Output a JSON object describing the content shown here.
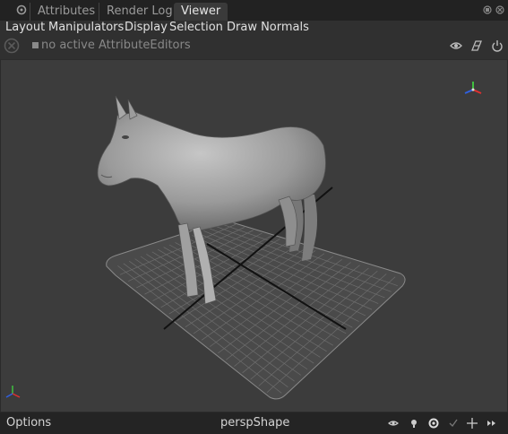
{
  "tabs": [
    {
      "label": "Attributes",
      "active": false
    },
    {
      "label": "Render Log",
      "active": false
    },
    {
      "label": "Viewer",
      "active": true
    }
  ],
  "window_buttons": [
    "float-icon",
    "close-icon"
  ],
  "menu": [
    "Layout",
    "Manipulators",
    "Display",
    "Selection",
    "Draw Normals"
  ],
  "toolbar": {
    "status": "no active AttributeEditors",
    "icons": [
      "eye-icon",
      "render-icon",
      "power-icon"
    ]
  },
  "viewport": {
    "object": "horse",
    "grid": true,
    "colors": {
      "background": "#3c3c3c",
      "grid": "#7a7a7a",
      "axis": "#111111",
      "gizmo_x": "#e03030",
      "gizmo_y": "#40c040",
      "gizmo_z": "#3060e0"
    }
  },
  "bottom": {
    "options_label": "Options",
    "camera": "perspShape",
    "icons": [
      "eye-icon",
      "light-icon",
      "gear-icon",
      "check-icon",
      "move-icon",
      "fast-forward-icon"
    ]
  }
}
